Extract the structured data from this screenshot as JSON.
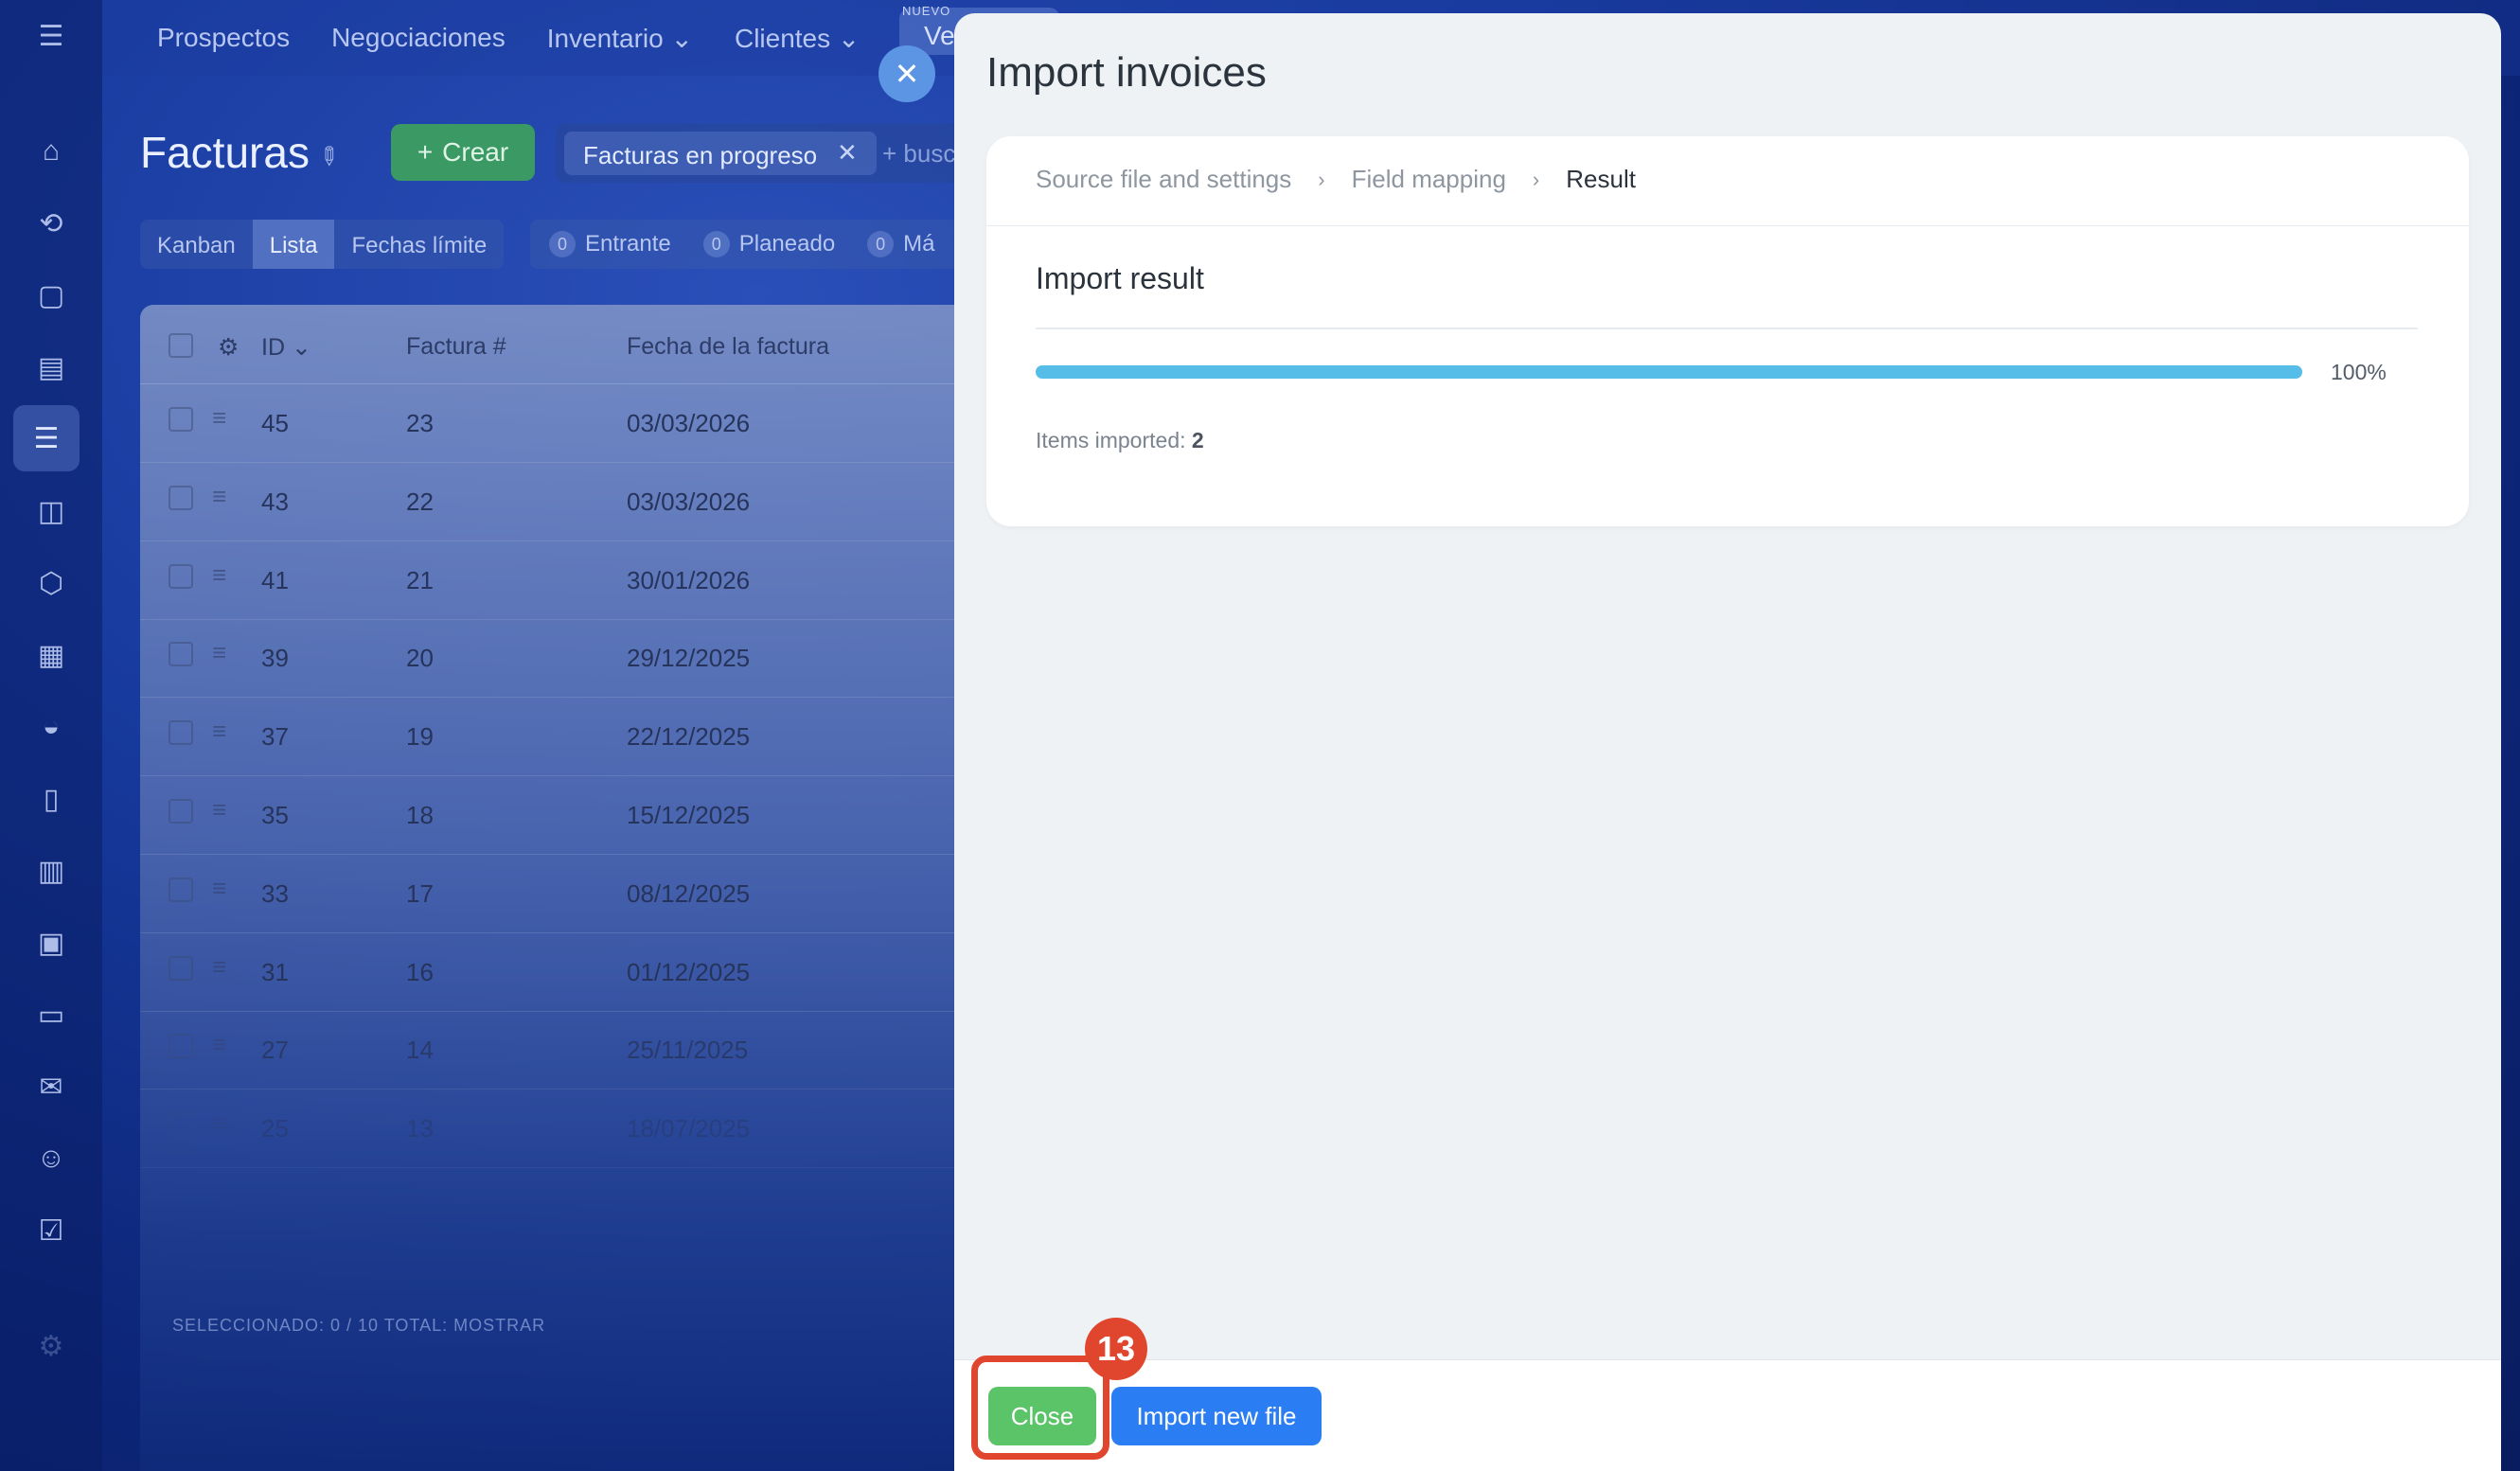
{
  "topnav": {
    "items": [
      "Prospectos",
      "Negociaciones",
      "Inventario ⌄",
      "Clientes ⌄"
    ],
    "new_tag": "NUEVO",
    "partial_item": "Ve"
  },
  "sidebar": {
    "icons": [
      "home-icon",
      "crm-icon",
      "chat-icon",
      "tasks-icon",
      "funnel-icon",
      "robot-icon",
      "hexagon-icon",
      "calendar-icon",
      "bot-icon",
      "document-icon",
      "store-icon",
      "presentation-icon",
      "inventory-icon",
      "mail-icon",
      "contacts-icon",
      "checklist-icon",
      "settings-icon"
    ]
  },
  "page": {
    "title": "Facturas",
    "create_label": "Crear",
    "filter_chip": "Facturas en progreso",
    "search_placeholder": "+ busc"
  },
  "view_tabs": [
    "Kanban",
    "Lista",
    "Fechas límite"
  ],
  "counters": [
    {
      "num": "0",
      "label": "Entrante"
    },
    {
      "num": "0",
      "label": "Planeado"
    },
    {
      "num": "0",
      "label": "Má"
    }
  ],
  "table": {
    "headers": [
      "ID ⌄",
      "Factura #",
      "Fecha de la factura"
    ],
    "rows": [
      [
        "45",
        "23",
        "03/03/2026"
      ],
      [
        "43",
        "22",
        "03/03/2026"
      ],
      [
        "41",
        "21",
        "30/01/2026"
      ],
      [
        "39",
        "20",
        "29/12/2025"
      ],
      [
        "37",
        "19",
        "22/12/2025"
      ],
      [
        "35",
        "18",
        "15/12/2025"
      ],
      [
        "33",
        "17",
        "08/12/2025"
      ],
      [
        "31",
        "16",
        "01/12/2025"
      ],
      [
        "27",
        "14",
        "25/11/2025"
      ],
      [
        "25",
        "13",
        "18/07/2025"
      ]
    ],
    "footer": "SELECCIONADO: 0 / 10     TOTAL: MOSTRAR"
  },
  "panel": {
    "title": "Import invoices",
    "steps": [
      "Source file and settings",
      "Field mapping",
      "Result"
    ],
    "result_title": "Import result",
    "progress_percent": 100,
    "progress_label": "100%",
    "items_imported_label": "Items imported:",
    "items_imported_value": "2",
    "close_label": "Close",
    "import_new_label": "Import new file"
  },
  "annotation": {
    "step_number": "13",
    "color": "#e0462e"
  },
  "colors": {
    "progress": "#56bde9",
    "close_button": "#5bc468",
    "import_button": "#2a7df2"
  }
}
